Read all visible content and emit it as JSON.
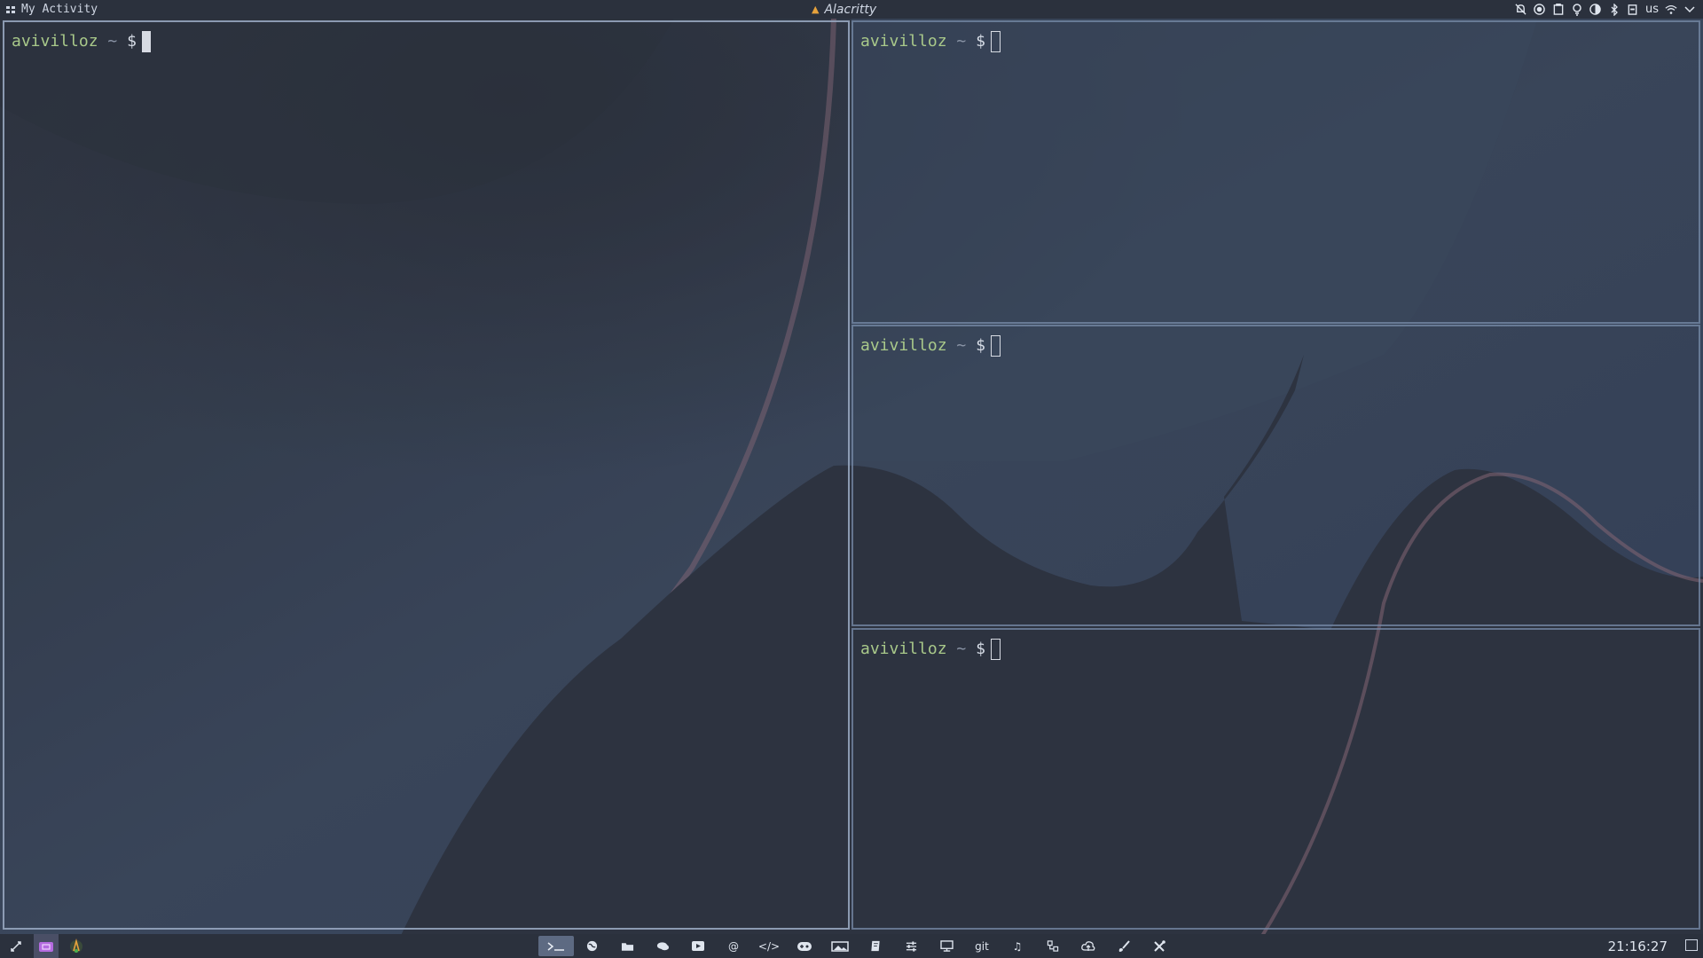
{
  "topbar": {
    "activity_label": "My Activity",
    "window_title": "Alacritty",
    "keyboard_layout": "us",
    "tray_icons": [
      "notifications-off-icon",
      "circle-record-icon",
      "clipboard-icon",
      "lightbulb-icon",
      "volume-icon",
      "bluetooth-icon",
      "battery-icon",
      "wifi-icon",
      "chevron-down-icon"
    ]
  },
  "terminals": [
    {
      "user": "avivilloz",
      "path": "~",
      "symbol": "$",
      "focused": true
    },
    {
      "user": "avivilloz",
      "path": "~",
      "symbol": "$",
      "focused": false
    },
    {
      "user": "avivilloz",
      "path": "~",
      "symbol": "$",
      "focused": false
    },
    {
      "user": "avivilloz",
      "path": "~",
      "symbol": "$",
      "focused": false
    }
  ],
  "dock": {
    "items": [
      {
        "icon": "terminal-icon",
        "label": "",
        "active": true
      },
      {
        "icon": "globe-icon",
        "label": "",
        "active": false
      },
      {
        "icon": "folder-icon",
        "label": "",
        "active": false
      },
      {
        "icon": "chat-icon",
        "label": "",
        "active": false
      },
      {
        "icon": "video-icon",
        "label": "",
        "active": false
      },
      {
        "icon": "at-sign-icon",
        "label": "@",
        "active": false
      },
      {
        "icon": "code-icon",
        "label": "</>",
        "active": false
      },
      {
        "icon": "gamepad-icon",
        "label": "",
        "active": false
      },
      {
        "icon": "image-icon",
        "label": "",
        "active": false
      },
      {
        "icon": "book-icon",
        "label": "",
        "active": false
      },
      {
        "icon": "sliders-icon",
        "label": "",
        "active": false
      },
      {
        "icon": "monitor-icon",
        "label": "",
        "active": false
      },
      {
        "icon": "git-icon",
        "label": "git",
        "active": false
      },
      {
        "icon": "music-icon",
        "label": "♫",
        "active": false
      },
      {
        "icon": "network-icon",
        "label": "",
        "active": false
      },
      {
        "icon": "cloud-upload-icon",
        "label": "",
        "active": false
      },
      {
        "icon": "brush-icon",
        "label": "",
        "active": false
      },
      {
        "icon": "tools-icon",
        "label": "",
        "active": false
      }
    ]
  },
  "clock": "21:16:27",
  "colors": {
    "bar_bg": "#2b313d",
    "prompt_user": "#a9c98a",
    "wallpaper_dark": "#2f3644",
    "wallpaper_light": "#3c4a61",
    "wallpaper_pink_edge": "#8a6a78"
  }
}
